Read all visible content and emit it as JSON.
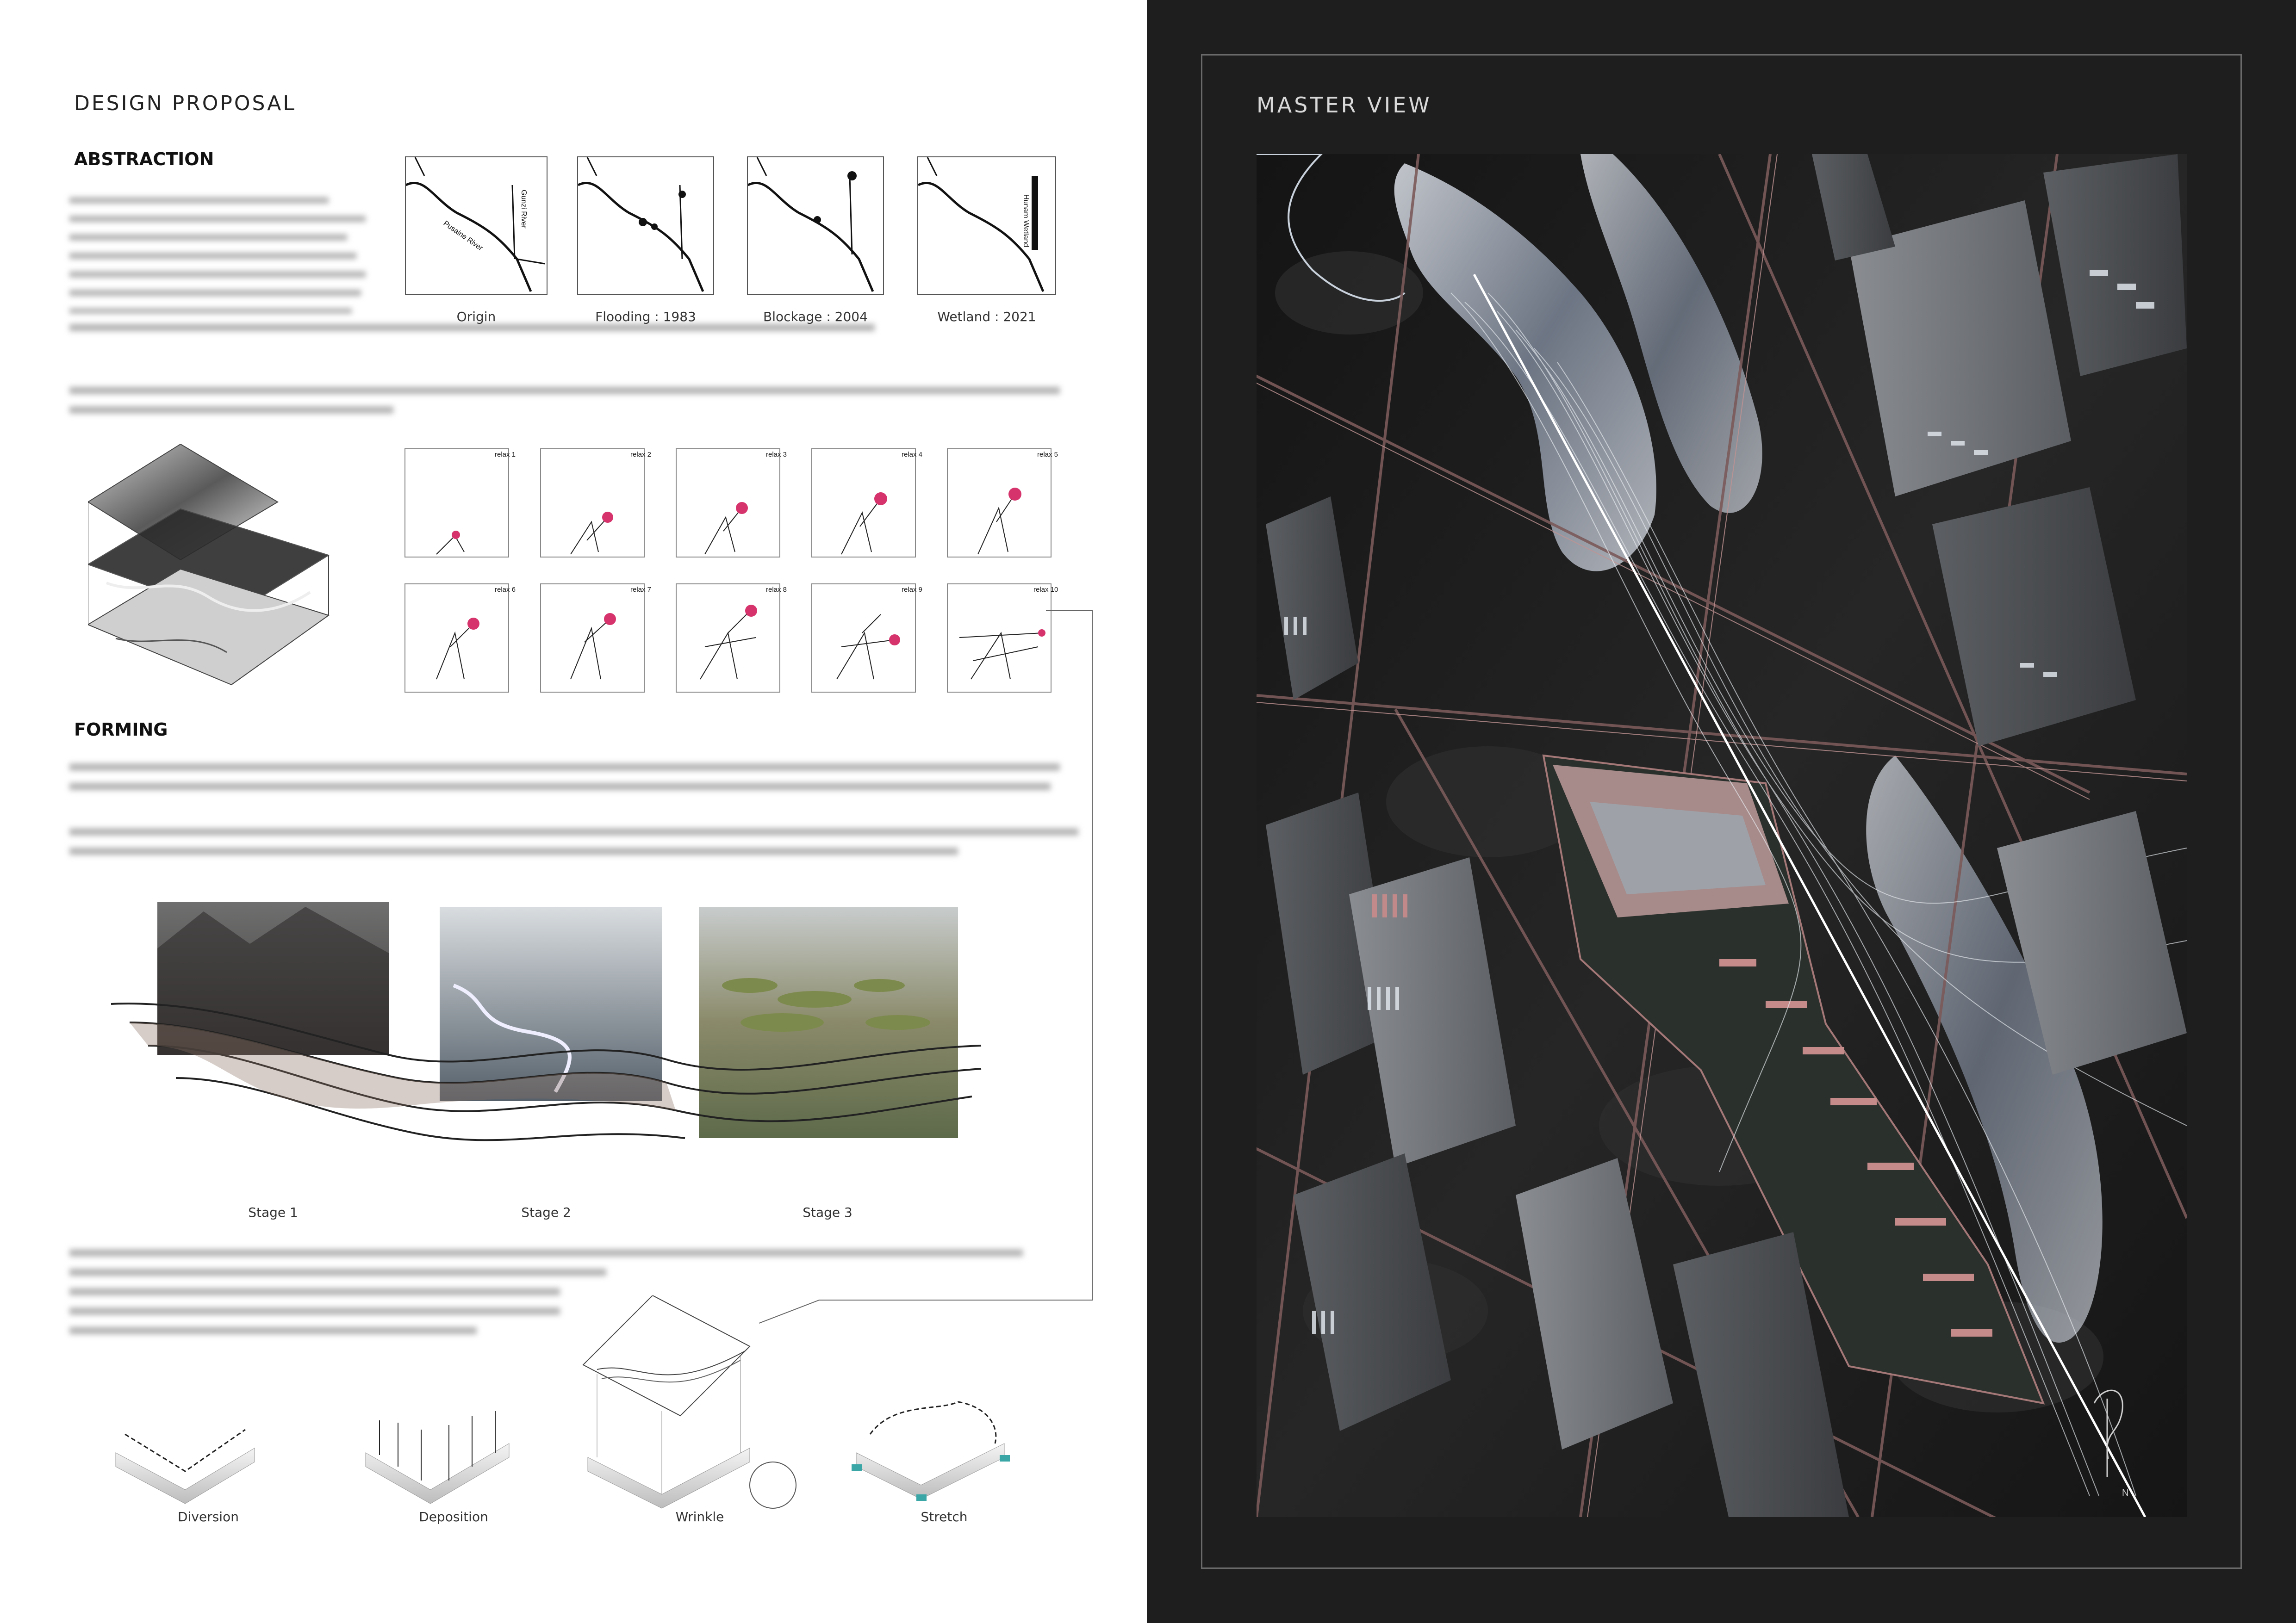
{
  "left_sheet": {
    "title": "DESIGN PROPOSAL",
    "abstraction": {
      "heading": "ABSTRACTION",
      "maps": [
        {
          "caption": "Origin",
          "labels": [
            "Pusaine River",
            "Gunzi River"
          ]
        },
        {
          "caption": "Flooding : 1983",
          "labels": []
        },
        {
          "caption": "Blockage : 2004",
          "labels": []
        },
        {
          "caption": "Wetland : 2021",
          "labels": [
            "Hunam Wetland"
          ]
        }
      ],
      "relax_labels": [
        "relax 1",
        "relax 2",
        "relax 3",
        "relax 4",
        "relax 5",
        "relax 6",
        "relax 7",
        "relax 8",
        "relax 9",
        "relax 10"
      ]
    },
    "forming": {
      "heading": "FORMING",
      "stages": [
        "Stage 1",
        "Stage 2",
        "Stage 3"
      ],
      "operations": [
        "Diversion",
        "Deposition",
        "Wrinkle",
        "Stretch"
      ]
    }
  },
  "right_sheet": {
    "title": "MASTER VIEW",
    "north_label": "N"
  },
  "colors": {
    "accent_magenta": "#d6336c",
    "dark_panel": "#1e1e1e",
    "frame_line": "#6a6a6a",
    "road_pink": "#b57a7a"
  }
}
